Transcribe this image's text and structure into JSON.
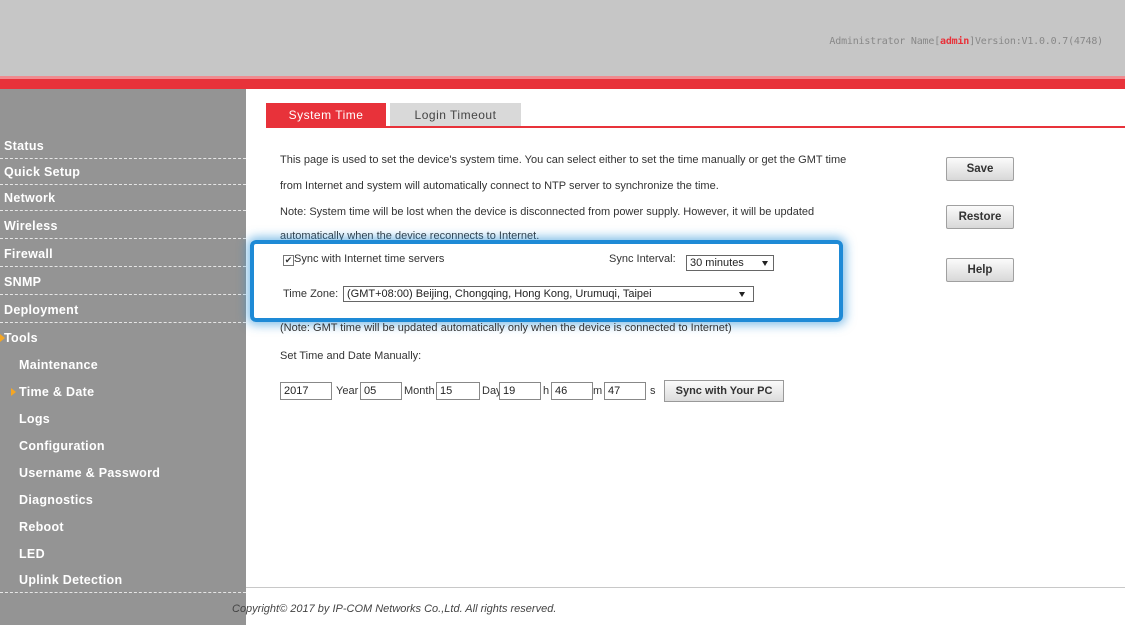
{
  "header": {
    "admin_prefix": "Administrator Name[",
    "admin_name": "admin",
    "version_text": "]Version:V1.0.0.7(4748)"
  },
  "sidebar": {
    "items": [
      {
        "label": "Status"
      },
      {
        "label": "Quick Setup"
      },
      {
        "label": "Network"
      },
      {
        "label": "Wireless"
      },
      {
        "label": "Firewall"
      },
      {
        "label": "SNMP"
      },
      {
        "label": "Deployment"
      },
      {
        "label": "Tools"
      }
    ],
    "sub_items": [
      {
        "label": "Maintenance"
      },
      {
        "label": "Time & Date"
      },
      {
        "label": "Logs"
      },
      {
        "label": "Configuration"
      },
      {
        "label": "Username & Password"
      },
      {
        "label": "Diagnostics"
      },
      {
        "label": "Reboot"
      },
      {
        "label": "LED"
      },
      {
        "label": "Uplink Detection"
      }
    ]
  },
  "tabs": [
    {
      "label": "System Time"
    },
    {
      "label": "Login Timeout"
    }
  ],
  "main": {
    "desc_line1": "This page is used to set the device's system time. You can select either to set the time manually or get the GMT time",
    "desc_line2": "from Internet and system will automatically connect to NTP server to synchronize the time.",
    "note_line1": "Note: System time will be lost when the device is disconnected from power supply. However, it will be updated",
    "note_line2": "automatically when the device reconnects to Internet.",
    "sync_label": "Sync with Internet time servers",
    "sync_checked": true,
    "sync_interval_label": "Sync Interval:",
    "sync_interval_value": "30 minutes",
    "timezone_label": "Time Zone:",
    "timezone_value": "(GMT+08:00) Beijing, Chongqing, Hong Kong, Urumuqi, Taipei",
    "gmt_note": "(Note: GMT time will be updated automatically only when the device is connected to Internet)",
    "manual_label": "Set Time and Date Manually:",
    "year": "2017",
    "year_unit": "Year",
    "month": "05",
    "month_unit": "Month",
    "day": "15",
    "day_unit": "Day",
    "hour": "19",
    "hour_unit": "h",
    "minute": "46",
    "minute_unit": "m",
    "second": "47",
    "second_unit": "s",
    "sync_pc_label": "Sync with Your PC"
  },
  "buttons": {
    "save": "Save",
    "restore": "Restore",
    "help": "Help"
  },
  "footer": {
    "copyright": "Copyright© 2017 by IP-COM Networks Co.,Ltd. All rights reserved."
  },
  "colors": {
    "accent": "#e8323a",
    "sidebar": "#949494",
    "highlight": "#1e8ad6",
    "active_arrow": "#f5a623"
  }
}
